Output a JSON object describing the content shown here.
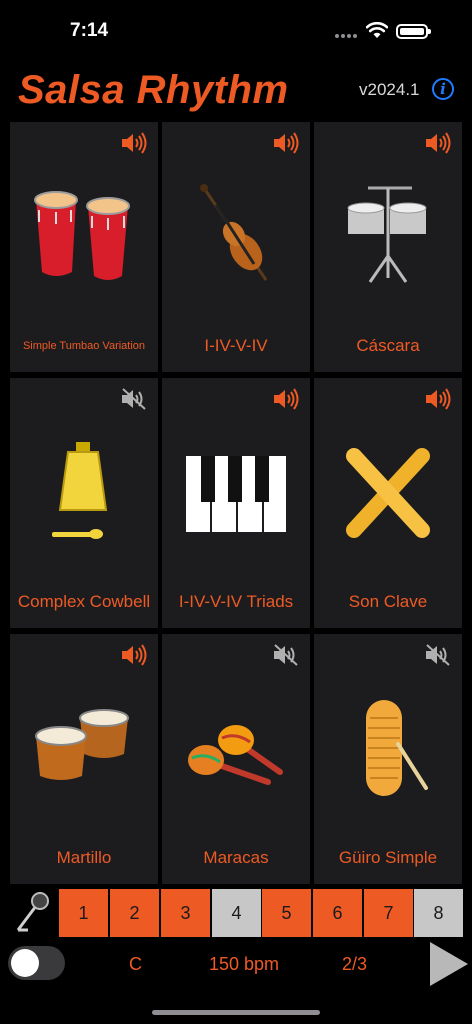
{
  "status_bar": {
    "time": "7:14"
  },
  "header": {
    "title": "Salsa Rhythm",
    "version": "v2024.1",
    "info_icon": "info-circle-icon"
  },
  "colors": {
    "accent": "#ee5a24",
    "cell_bg": "#1c1c1e",
    "step_on": "#ee5a24",
    "step_off": "#c7c7c7",
    "info_blue": "#1f7bff"
  },
  "instruments": [
    {
      "label": "Simple Tumbao Variation",
      "icon": "conga-drums-icon",
      "sound": "on"
    },
    {
      "label": "I-IV-V-IV",
      "icon": "bass-violin-icon",
      "sound": "on"
    },
    {
      "label": "Cáscara",
      "icon": "timbales-icon",
      "sound": "on"
    },
    {
      "label": "Complex Cowbell",
      "icon": "cowbell-icon",
      "sound": "muted"
    },
    {
      "label": "I-IV-V-IV Triads",
      "icon": "piano-keys-icon",
      "sound": "on"
    },
    {
      "label": "Son Clave",
      "icon": "claves-icon",
      "sound": "on"
    },
    {
      "label": "Martillo",
      "icon": "bongo-drums-icon",
      "sound": "on"
    },
    {
      "label": "Maracas",
      "icon": "maracas-icon",
      "sound": "muted"
    },
    {
      "label": "Güiro Simple",
      "icon": "guiro-icon",
      "sound": "muted"
    }
  ],
  "sequencer": {
    "mic_icon": "microphone-icon",
    "steps": [
      {
        "label": "1",
        "active": true
      },
      {
        "label": "2",
        "active": true
      },
      {
        "label": "3",
        "active": true
      },
      {
        "label": "4",
        "active": false
      },
      {
        "label": "5",
        "active": true
      },
      {
        "label": "6",
        "active": true
      },
      {
        "label": "7",
        "active": true
      },
      {
        "label": "8",
        "active": false
      }
    ]
  },
  "controls": {
    "toggle_on": false,
    "key": "C",
    "tempo": "150 bpm",
    "clave": "2/3",
    "play_icon": "play-icon"
  }
}
